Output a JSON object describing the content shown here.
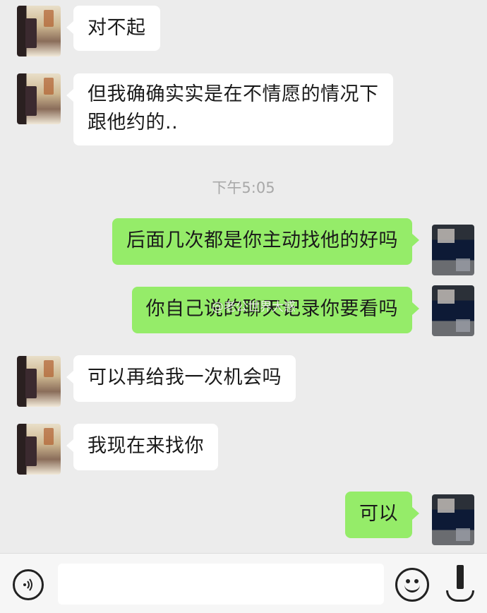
{
  "timestamp": "下午5:05",
  "watermark": "@老公世界大惑",
  "messages": [
    {
      "side": "in",
      "lines": [
        "对不起"
      ]
    },
    {
      "side": "in",
      "lines": [
        "但我确确实实是在不情愿的情况下",
        "跟他约的.."
      ]
    },
    {
      "side": "out",
      "lines": [
        "后面几次都是你主动找他的好吗"
      ]
    },
    {
      "side": "out",
      "lines": [
        "你自己说的聊天记录你要看吗"
      ]
    },
    {
      "side": "in",
      "lines": [
        "可以再给我一次机会吗"
      ]
    },
    {
      "side": "in",
      "lines": [
        "我现在来找你"
      ]
    },
    {
      "side": "out",
      "lines": [
        "可以"
      ]
    }
  ],
  "input_bar": {
    "voice_icon": "voice-icon",
    "emoji_icon": "emoji-icon",
    "more_icon": "more-icon",
    "text_value": ""
  },
  "colors": {
    "background": "#ececec",
    "incoming_bubble": "#ffffff",
    "outgoing_bubble": "#95ec69"
  }
}
